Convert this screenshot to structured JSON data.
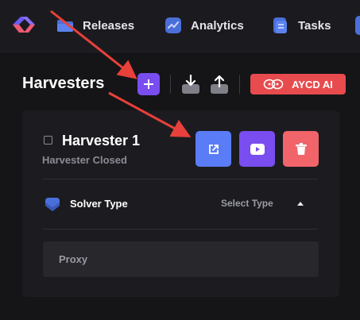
{
  "nav": {
    "logo_icon": "app-logo",
    "items": [
      {
        "label": "Releases",
        "icon": "folder-icon"
      },
      {
        "label": "Analytics",
        "icon": "chart-icon"
      },
      {
        "label": "Tasks",
        "icon": "tasks-icon"
      }
    ]
  },
  "header": {
    "title": "Harvesters",
    "add_icon": "plus-icon",
    "import_icon": "download-icon",
    "export_icon": "upload-icon",
    "aycd_label": "AYCD AI"
  },
  "harvester": {
    "name": "Harvester 1",
    "status": "Harvester Closed",
    "actions": [
      {
        "name": "open",
        "icon": "external-link-icon",
        "color": "#5b7cf7"
      },
      {
        "name": "youtube",
        "icon": "play-icon",
        "color": "#7a4df0"
      },
      {
        "name": "delete",
        "icon": "trash-icon",
        "color": "#f0646a"
      }
    ],
    "solver_label": "Solver Type",
    "solver_select_placeholder": "Select Type",
    "proxy_label": "Proxy"
  },
  "colors": {
    "accent_purple": "#7a4df0",
    "accent_blue": "#5b7cf7",
    "accent_red": "#e84b4e",
    "annotation_arrow": "#e8403a"
  }
}
